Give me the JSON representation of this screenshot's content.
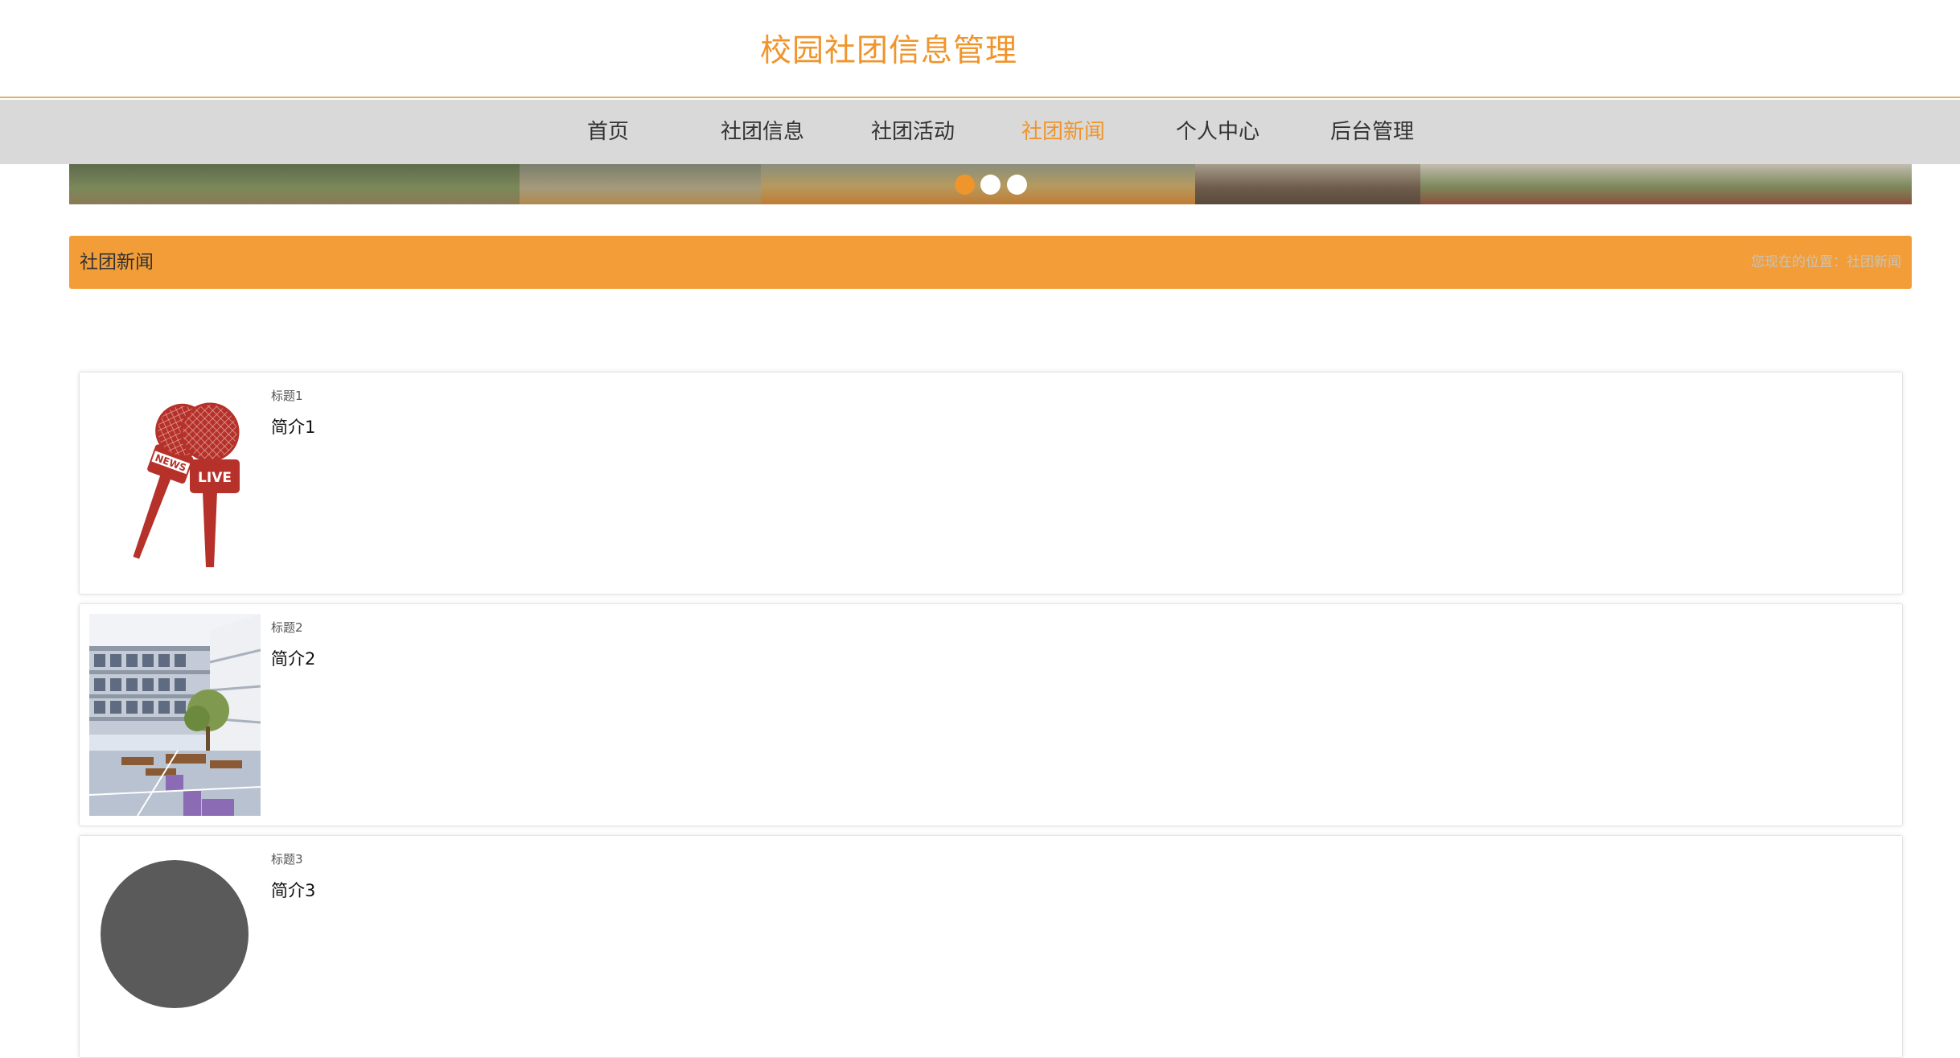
{
  "header": {
    "title": "校园社团信息管理"
  },
  "nav": {
    "items": [
      {
        "label": "首页"
      },
      {
        "label": "社团信息"
      },
      {
        "label": "社团活动"
      },
      {
        "label": "社团新闻"
      },
      {
        "label": "个人中心"
      },
      {
        "label": "后台管理"
      }
    ],
    "active_index": 3
  },
  "carousel": {
    "slide_count": 3,
    "active_index": 0
  },
  "section": {
    "title": "社团新闻",
    "breadcrumb_prefix": "您现在的位置：",
    "breadcrumb_current": "社团新闻"
  },
  "news": [
    {
      "title": "标题1",
      "intro": "简介1",
      "thumb_icon": "news-live-microphones-icon"
    },
    {
      "title": "标题2",
      "intro": "简介2",
      "thumb_icon": "campus-building-photo"
    },
    {
      "title": "标题3",
      "intro": "简介3",
      "thumb_icon": "gray-circle-image"
    }
  ],
  "colors": {
    "accent": "#f0952b",
    "section_bar": "#f29d37",
    "nav_bg": "#d9d9d9",
    "mic_red": "#b5312a"
  }
}
